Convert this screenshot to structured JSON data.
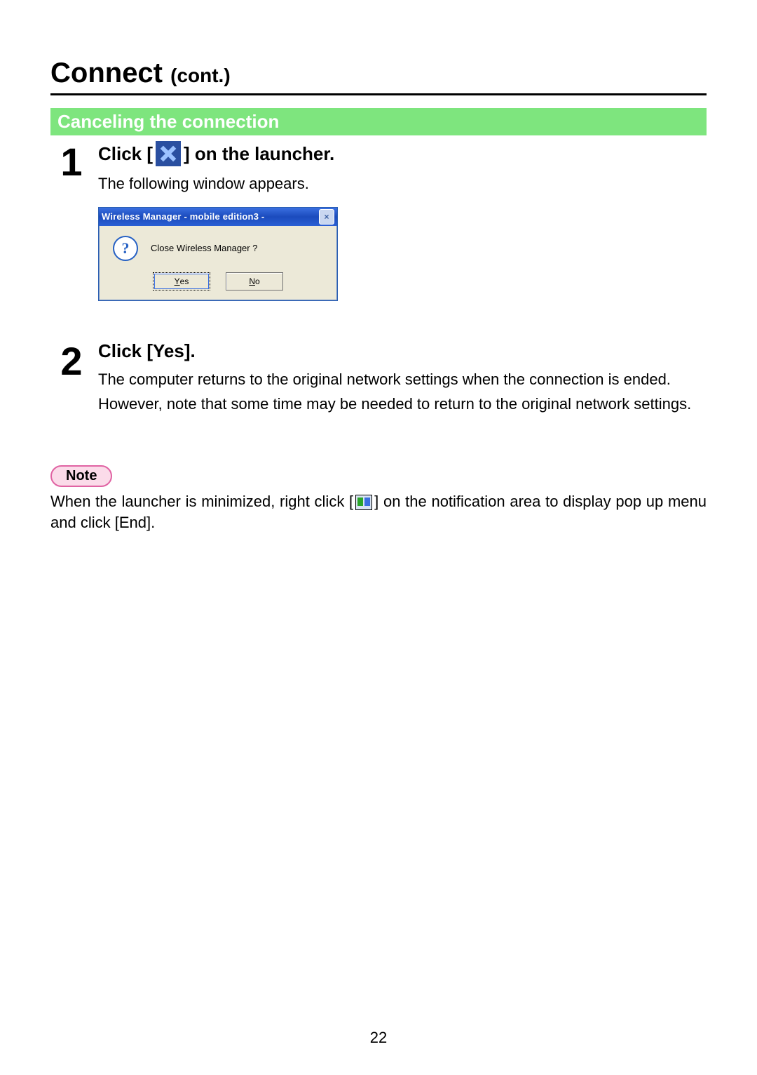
{
  "pageTitle": {
    "main": "Connect",
    "cont": "(cont.)"
  },
  "sectionTitle": "Canceling the connection",
  "step1": {
    "num": "1",
    "prefix": "Click [",
    "suffix": "] on the launcher.",
    "para": "The following window appears."
  },
  "dialog": {
    "title": "Wireless Manager - mobile edition3 -",
    "message": "Close Wireless Manager ?",
    "yesUnderline": "Y",
    "yesRest": "es",
    "noUnderline": "N",
    "noRest": "o"
  },
  "step2": {
    "num": "2",
    "heading": "Click [Yes].",
    "para1": "The computer returns to the original network settings when the connection is ended.",
    "para2": "However, note that some time may be needed to return to the original network settings."
  },
  "note": {
    "label": "Note",
    "textPrefix": "When the launcher is minimized, right click [",
    "textSuffix": "] on the notification area to display pop up menu and click [End]."
  },
  "pageNumber": "22"
}
